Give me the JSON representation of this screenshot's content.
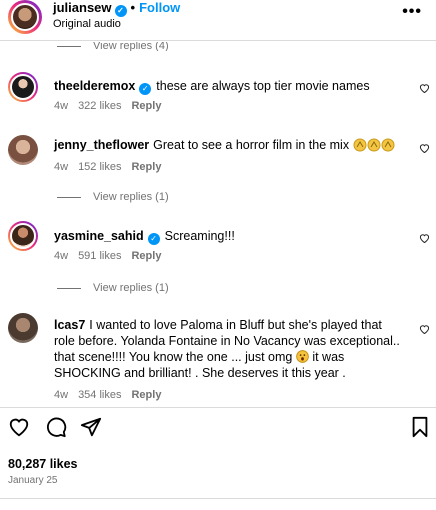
{
  "header": {
    "username": "juliansew",
    "follow_label": "Follow",
    "subtitle": "Original audio",
    "more_label": "•••"
  },
  "view_replies_top": "View replies (4)",
  "comments": [
    {
      "username": "theelderemox",
      "verified": true,
      "text": "these are always top tier movie names",
      "age": "4w",
      "likes": "322 likes",
      "reply_label": "Reply"
    },
    {
      "username": "jenny_theflower",
      "verified": false,
      "text": "Great to see a horror film in the mix",
      "emoji": "clapping-hands x3",
      "age": "4w",
      "likes": "152 likes",
      "reply_label": "Reply",
      "view_replies": "View replies (1)"
    },
    {
      "username": "yasmine_sahid",
      "verified": true,
      "text": "Screaming!!!",
      "age": "4w",
      "likes": "591 likes",
      "reply_label": "Reply",
      "view_replies": "View replies (1)"
    },
    {
      "username": "lcas7",
      "verified": false,
      "text_part1": "I wanted to love Paloma in Bluff but she's played that role before. Yolanda Fontaine in No Vacancy was exceptional.. that scene!!!! You know the one ... just omg",
      "text_part2": "it was SHOCKING and brilliant! . She deserves it this year .",
      "emoji": "surprised-face",
      "age": "4w",
      "likes": "354 likes",
      "reply_label": "Reply"
    }
  ],
  "footer": {
    "likes": "80,287 likes",
    "date": "January 25"
  },
  "colors": {
    "accent": "#0095f6",
    "muted": "#737373",
    "divider": "#dbdbdb"
  }
}
